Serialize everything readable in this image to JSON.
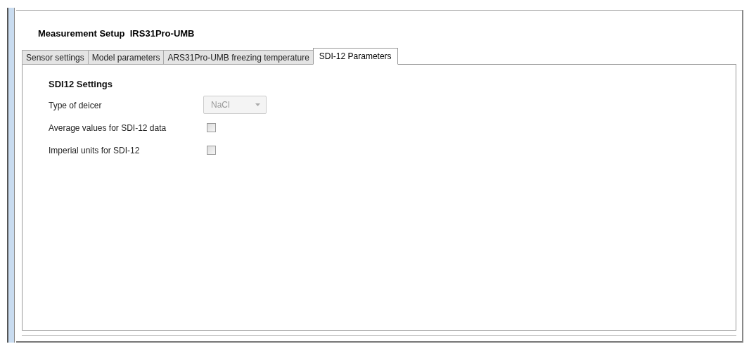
{
  "title": "Measurement Setup  IRS31Pro-UMB",
  "tabs": [
    {
      "label": "Sensor settings",
      "selected": false
    },
    {
      "label": "Model parameters",
      "selected": false
    },
    {
      "label": "ARS31Pro-UMB freezing temperature",
      "selected": false
    },
    {
      "label": "SDI-12 Parameters",
      "selected": true
    }
  ],
  "section_title": "SDI12 Settings",
  "rows": [
    {
      "kind": "dropdown",
      "label": "Type of deicer",
      "value": "NaCl",
      "disabled": true
    },
    {
      "kind": "checkbox",
      "label": "Average values for SDI-12 data",
      "checked": false
    },
    {
      "kind": "checkbox",
      "label": "Imperial units for SDI-12",
      "checked": false
    }
  ]
}
